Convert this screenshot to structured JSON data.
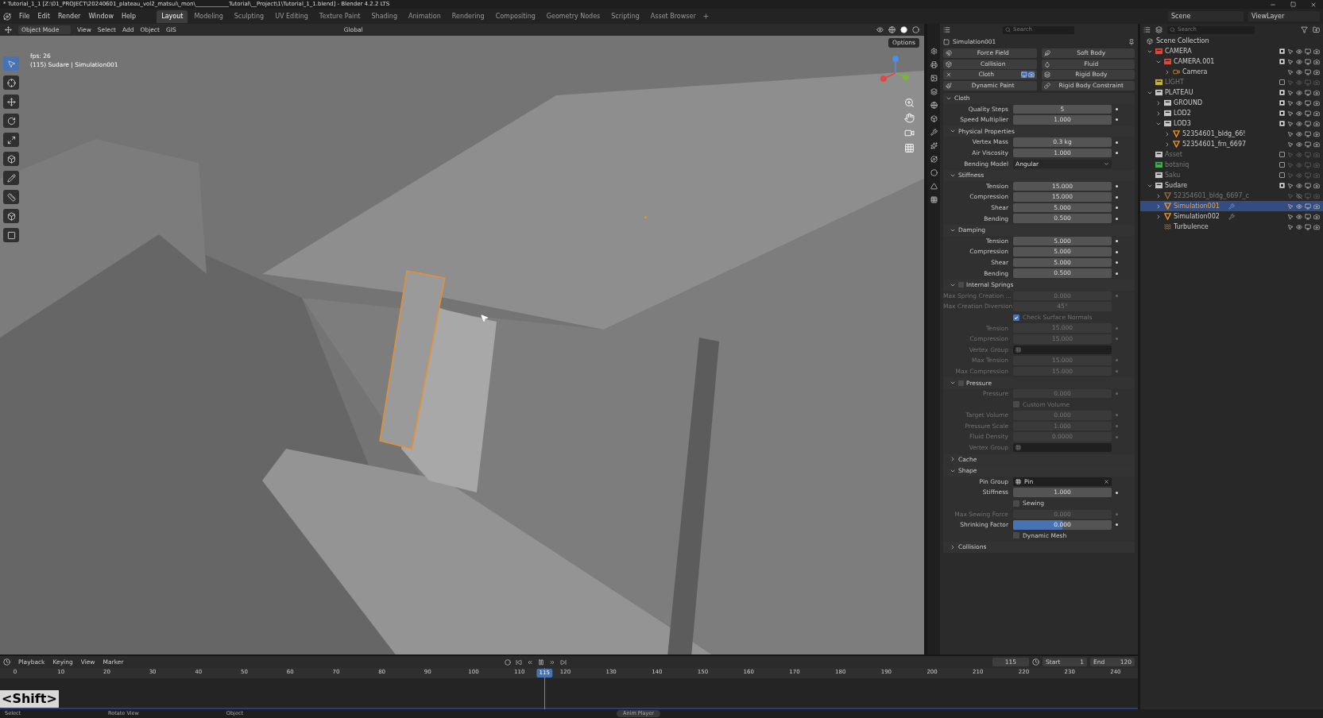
{
  "title_bar": {
    "title": "* Tutorial_1_1 [Z:\\01_PROJECT\\20240601_plateau_vol2_matsui\\_mon\\____________Tutorial\\__Project\\1\\Tutorial_1_1.blend] - Blender 4.2.2 LTS"
  },
  "menu_bar": {
    "menus": [
      "File",
      "Edit",
      "Render",
      "Window",
      "Help"
    ],
    "workspaces": [
      {
        "label": "Layout",
        "selected": true
      },
      {
        "label": "Modeling",
        "selected": false
      },
      {
        "label": "Sculpting",
        "selected": false
      },
      {
        "label": "UV Editing",
        "selected": false
      },
      {
        "label": "Texture Paint",
        "selected": false
      },
      {
        "label": "Shading",
        "selected": false
      },
      {
        "label": "Animation",
        "selected": false
      },
      {
        "label": "Rendering",
        "selected": false
      },
      {
        "label": "Compositing",
        "selected": false
      },
      {
        "label": "Geometry Nodes",
        "selected": false
      },
      {
        "label": "Scripting",
        "selected": false
      },
      {
        "label": "Asset Browser",
        "selected": false
      }
    ],
    "scene": "Scene",
    "view_layer": "ViewLayer"
  },
  "viewport": {
    "header": {
      "mode": "Object Mode",
      "menus": [
        "View",
        "Select",
        "Add",
        "Object"
      ],
      "gis": "GIS",
      "orientation": "Global",
      "options": "Options"
    },
    "overlay": {
      "fps": "fps: 26",
      "object": "(115) Sudare | Simulation001"
    },
    "tools": [
      {
        "selected": true
      },
      {
        "selected": false
      },
      {
        "selected": false
      },
      {
        "selected": false
      },
      {
        "selected": false
      },
      {
        "selected": false
      },
      {
        "selected": false
      },
      {
        "selected": false
      },
      {
        "selected": false
      },
      {
        "selected": false
      }
    ]
  },
  "properties": {
    "search_placeholder": "Search",
    "object": "Simulation001",
    "physics": [
      {
        "label": "Force Field",
        "enabled": false
      },
      {
        "label": "Soft Body",
        "enabled": false
      },
      {
        "label": "Collision",
        "enabled": false
      },
      {
        "label": "Fluid",
        "enabled": false
      },
      {
        "label": "Cloth",
        "enabled": true
      },
      {
        "label": "Rigid Body",
        "enabled": false
      },
      {
        "label": "Dynamic Paint",
        "enabled": false
      },
      {
        "label": "Rigid Body Constraint",
        "enabled": false
      }
    ],
    "panel": {
      "title": "Cloth",
      "expanded": true,
      "rows": [
        {
          "kind": "number",
          "label": "Quality Steps",
          "value": "5",
          "disabled": false
        },
        {
          "kind": "number",
          "label": "Speed Multiplier",
          "value": "1.000",
          "disabled": false
        },
        {
          "kind": "subpanel",
          "title": "Physical Properties",
          "expanded": true,
          "rows": [
            {
              "kind": "number",
              "label": "Vertex Mass",
              "value": "0.3 kg",
              "disabled": false
            },
            {
              "kind": "number",
              "label": "Air Viscosity",
              "value": "1.000",
              "disabled": false
            },
            {
              "kind": "dropdown",
              "label": "Bending Model",
              "value": "Angular",
              "disabled": false
            }
          ]
        },
        {
          "kind": "subpanel",
          "title": "Stiffness",
          "expanded": true,
          "rows": [
            {
              "kind": "number",
              "label": "Tension",
              "value": "15.000",
              "disabled": false
            },
            {
              "kind": "number",
              "label": "Compression",
              "value": "15.000",
              "disabled": false
            },
            {
              "kind": "number",
              "label": "Shear",
              "value": "5.000",
              "disabled": false
            },
            {
              "kind": "number",
              "label": "Bending",
              "value": "0.500",
              "disabled": false
            }
          ]
        },
        {
          "kind": "subpanel",
          "title": "Damping",
          "expanded": true,
          "rows": [
            {
              "kind": "number",
              "label": "Tension",
              "value": "5.000",
              "disabled": false
            },
            {
              "kind": "number",
              "label": "Compression",
              "value": "5.000",
              "disabled": false
            },
            {
              "kind": "number",
              "label": "Shear",
              "value": "5.000",
              "disabled": false
            },
            {
              "kind": "number",
              "label": "Bending",
              "value": "0.500",
              "disabled": false
            }
          ]
        },
        {
          "kind": "subpanel",
          "title": "Internal Springs",
          "expanded": true,
          "enabled": false,
          "rows": [
            {
              "kind": "number",
              "label": "Max Spring Creation ...",
              "value": "0.000",
              "disabled": true
            },
            {
              "kind": "field",
              "label": "Max Creation Diversion",
              "value": "45°",
              "disabled": true
            },
            {
              "kind": "checkbox",
              "label": "Check Surface Normals",
              "checked": true,
              "disabled": true
            },
            {
              "kind": "number",
              "label": "Tension",
              "value": "15.000",
              "disabled": true
            },
            {
              "kind": "number",
              "label": "Compression",
              "value": "15.000",
              "disabled": true
            },
            {
              "kind": "group",
              "label": "Vertex Group",
              "disabled": true
            },
            {
              "kind": "number",
              "label": "Max Tension",
              "value": "15.000",
              "disabled": true
            },
            {
              "kind": "number",
              "label": "Max Compression",
              "value": "15.000",
              "disabled": true
            }
          ]
        },
        {
          "kind": "subpanel",
          "title": "Pressure",
          "expanded": true,
          "enabled": false,
          "rows": [
            {
              "kind": "number",
              "label": "Pressure",
              "value": "0.000",
              "disabled": true
            },
            {
              "kind": "checkbox",
              "label": "Custom Volume",
              "checked": false,
              "disabled": true
            },
            {
              "kind": "number",
              "label": "Target Volume",
              "value": "0.000",
              "disabled": true
            },
            {
              "kind": "number",
              "label": "Pressure Scale",
              "value": "1.000",
              "disabled": true
            },
            {
              "kind": "number",
              "label": "Fluid Density",
              "value": "0.0000",
              "disabled": true
            },
            {
              "kind": "group",
              "label": "Vertex Group",
              "disabled": true
            }
          ]
        },
        {
          "kind": "subpanel",
          "title": "Cache",
          "expanded": false,
          "rows": []
        },
        {
          "kind": "subpanel",
          "title": "Shape",
          "expanded": true,
          "rows": [
            {
              "kind": "group",
              "label": "Pin Group",
              "value": "Pin",
              "disabled": false
            },
            {
              "kind": "number",
              "label": "Stiffness",
              "value": "1.000",
              "disabled": false
            },
            {
              "kind": "checkbox",
              "label": "Sewing",
              "checked": false,
              "disabled": false
            },
            {
              "kind": "number",
              "label": "Max Sewing Force",
              "value": "0.000",
              "disabled": true
            },
            {
              "kind": "slider",
              "label": "Shrinking Factor",
              "value": "0.000",
              "level": 0.5,
              "disabled": false
            },
            {
              "kind": "checkbox",
              "label": "Dynamic Mesh",
              "checked": false,
              "disabled": false
            }
          ]
        },
        {
          "kind": "subpanel",
          "title": "Collisions",
          "expanded": false,
          "rows": []
        }
      ]
    }
  },
  "outliner": {
    "search_placeholder": "Search",
    "root": "Scene Collection",
    "items": [
      {
        "name": "CAMERA",
        "kind": "collection",
        "color": "#e0463c",
        "expanded": true,
        "checked": true,
        "visible": true,
        "selected": false,
        "children": [
          {
            "name": "CAMERA.001",
            "kind": "collection",
            "color": "#e0463c",
            "expanded": true,
            "checked": true,
            "visible": true,
            "selected": false,
            "children": [
              {
                "name": "Camera",
                "kind": "camera",
                "expanded": false,
                "visible": true,
                "selected": false
              }
            ]
          }
        ]
      },
      {
        "name": "LIGHT",
        "kind": "collection",
        "color": "#c9b03a",
        "checked": false,
        "visible": true,
        "selected": false
      },
      {
        "name": "PLATEAU",
        "kind": "collection",
        "color": "#c8c8c8",
        "expanded": true,
        "checked": true,
        "visible": true,
        "selected": false,
        "children": [
          {
            "name": "GROUND",
            "kind": "collection",
            "color": "#c8c8c8",
            "expanded": false,
            "checked": true,
            "visible": true,
            "selected": false
          },
          {
            "name": "LOD2",
            "kind": "collection",
            "color": "#c8c8c8",
            "expanded": false,
            "checked": true,
            "visible": true,
            "selected": false
          },
          {
            "name": "LOD3",
            "kind": "collection",
            "color": "#c8c8c8",
            "expanded": true,
            "checked": true,
            "visible": true,
            "selected": false,
            "children": [
              {
                "name": "52354601_bldg_66!",
                "kind": "mesh",
                "expanded": false,
                "visible": true,
                "selected": false
              },
              {
                "name": "52354601_frn_6697",
                "kind": "mesh",
                "expanded": false,
                "visible": true,
                "selected": false
              }
            ]
          }
        ]
      },
      {
        "name": "Asset",
        "kind": "collection",
        "color": "#c8c8c8",
        "checked": false,
        "visible": true,
        "selected": false
      },
      {
        "name": "botaniq",
        "kind": "collection",
        "color": "#3fae4a",
        "checked": false,
        "visible": true,
        "selected": false
      },
      {
        "name": "Saku",
        "kind": "collection",
        "color": "#c8c8c8",
        "checked": false,
        "visible": true,
        "selected": false
      },
      {
        "name": "Sudare",
        "kind": "collection",
        "color": "#c8c8c8",
        "expanded": true,
        "checked": true,
        "visible": true,
        "selected": false,
        "children": [
          {
            "name": "52354601_bldg_6697_c",
            "kind": "mesh",
            "expanded": false,
            "visible": false,
            "selected": false
          },
          {
            "name": "Simulation001",
            "kind": "mesh",
            "expanded": false,
            "visible": true,
            "selected": true,
            "modifier": true
          },
          {
            "name": "Simulation002",
            "kind": "mesh",
            "expanded": false,
            "visible": true,
            "selected": false,
            "modifier": true
          },
          {
            "name": "Turbulence",
            "kind": "force",
            "visible": true,
            "selected": false
          }
        ]
      }
    ]
  },
  "timeline": {
    "menus": [
      "Playback",
      "Keying",
      "View",
      "Marker"
    ],
    "current_frame": "115",
    "start_label": "Start",
    "start": "1",
    "end_label": "End",
    "end": "120",
    "ticks": [
      "0",
      "10",
      "20",
      "30",
      "40",
      "50",
      "60",
      "70",
      "80",
      "90",
      "100",
      "110",
      "120",
      "130",
      "140",
      "150",
      "160",
      "170",
      "180",
      "190",
      "200",
      "210",
      "220",
      "230",
      "240"
    ],
    "playhead": {
      "label": "115",
      "level": 0.479
    }
  },
  "key_overlay": "<Shift>",
  "status_bar": {
    "items": [
      "Select",
      "Rotate View",
      "Object"
    ],
    "notice": "Anim Player"
  }
}
